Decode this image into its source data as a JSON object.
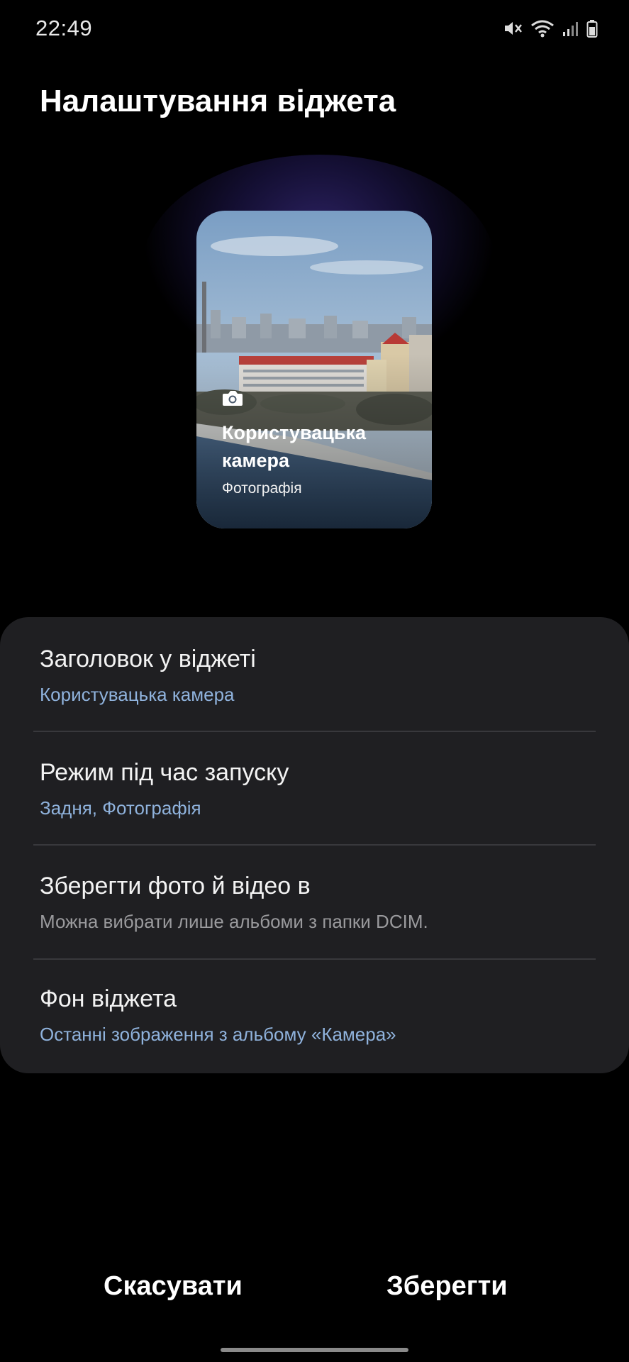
{
  "status_bar": {
    "time": "22:49",
    "icons": [
      "mute-icon",
      "wifi-icon",
      "signal-icon",
      "battery-icon"
    ]
  },
  "header": {
    "title": "Налаштування віджета"
  },
  "widget_preview": {
    "title": "Користувацька камера",
    "subtitle": "Фотографія",
    "icon": "camera-icon"
  },
  "settings": {
    "items": [
      {
        "title": "Заголовок у віджеті",
        "value": "Користувацька камера"
      },
      {
        "title": "Режим під час запуску",
        "value": "Задня, Фотографія"
      },
      {
        "title": "Зберегти фото й відео в",
        "value": "Можна вибрати лише альбоми з папки DCIM."
      },
      {
        "title": "Фон віджета",
        "value": "Останні зображення з альбому «Камера»"
      }
    ]
  },
  "actions": {
    "cancel_label": "Скасувати",
    "save_label": "Зберегти"
  },
  "colors": {
    "background": "#000000",
    "panel": "#1f1f22",
    "accent_text": "#8fb2dc",
    "muted_text": "#9a9a9d"
  }
}
